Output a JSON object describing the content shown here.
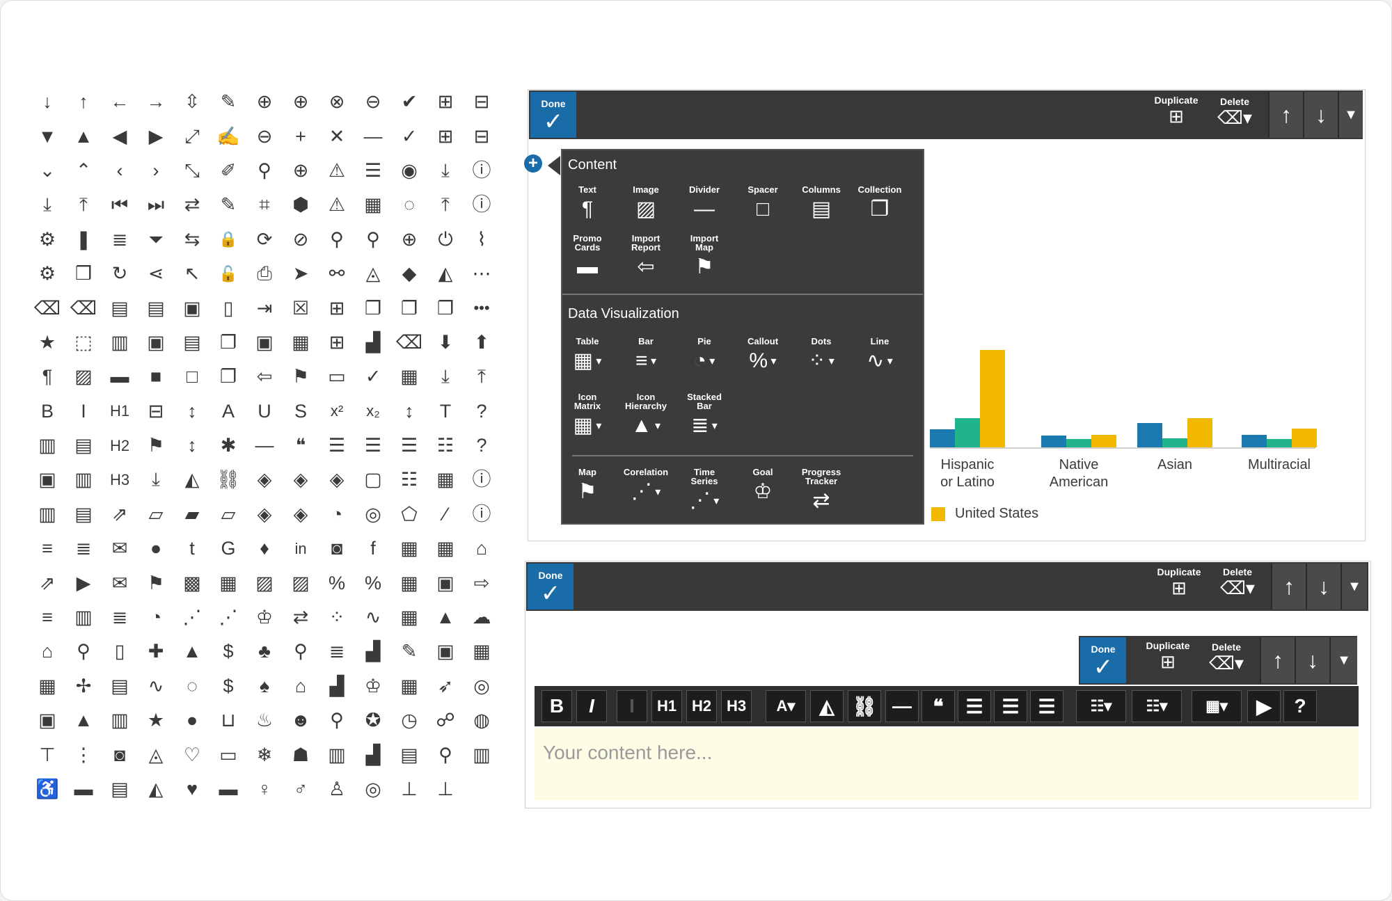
{
  "icon_grid": [
    [
      "arrow-down-icon",
      "↓"
    ],
    [
      "arrow-up-icon",
      "↑"
    ],
    [
      "arrow-left-icon",
      "←"
    ],
    [
      "arrow-right-icon",
      "→"
    ],
    [
      "resize-vertical-icon",
      "⇳"
    ],
    [
      "pencil-icon",
      "✎"
    ],
    [
      "zoom-in-icon",
      "⊕"
    ],
    [
      "circle-plus-icon",
      "⊕"
    ],
    [
      "circle-x-icon",
      "⊗"
    ],
    [
      "circle-minus-icon",
      "⊖"
    ],
    [
      "circle-check-icon",
      "✔"
    ],
    [
      "square-plus-icon",
      "⊞"
    ],
    [
      "square-minus-icon",
      "⊟"
    ],
    [
      "triangle-down-icon",
      "▼"
    ],
    [
      "triangle-up-icon",
      "▲"
    ],
    [
      "triangle-left-icon",
      "◀"
    ],
    [
      "triangle-right-icon",
      "▶"
    ],
    [
      "expand-icon",
      "⤢"
    ],
    [
      "edit-lines-icon",
      "✍"
    ],
    [
      "zoom-out-icon",
      "⊖"
    ],
    [
      "plus-icon",
      "+"
    ],
    [
      "times-icon",
      "✕"
    ],
    [
      "minus-icon",
      "—"
    ],
    [
      "check-icon",
      "✓"
    ],
    [
      "square-plus-outline-icon",
      "⊞"
    ],
    [
      "square-minus-outline-icon",
      "⊟"
    ],
    [
      "chevron-down-icon",
      "⌄"
    ],
    [
      "chevron-up-icon",
      "⌃"
    ],
    [
      "chevron-left-icon",
      "‹"
    ],
    [
      "chevron-right-icon",
      "›"
    ],
    [
      "compress-icon",
      "⤡"
    ],
    [
      "edit-box-icon",
      "✐"
    ],
    [
      "search-icon",
      "⚲"
    ],
    [
      "circle-plus-filled-icon",
      "⊕"
    ],
    [
      "warning-outline-icon",
      "⚠"
    ],
    [
      "list-lines-icon",
      "☰"
    ],
    [
      "eye-icon",
      "◉"
    ],
    [
      "download-icon",
      "⤓"
    ],
    [
      "info-filled-icon",
      "ⓘ"
    ],
    [
      "download-bar-icon",
      "⤓"
    ],
    [
      "upload-bar-icon",
      "⤒"
    ],
    [
      "first-icon",
      "⏮"
    ],
    [
      "last-icon",
      "⏭"
    ],
    [
      "swap-icon",
      "⇄"
    ],
    [
      "edit-doc-icon",
      "✎"
    ],
    [
      "tag-outline-icon",
      "⌗"
    ],
    [
      "tag-icon",
      "⬢"
    ],
    [
      "warning-icon",
      "⚠"
    ],
    [
      "grid-icon",
      "▦"
    ],
    [
      "eye-off-icon",
      "◌"
    ],
    [
      "upload-icon",
      "⤒"
    ],
    [
      "info-outline-icon",
      "ⓘ"
    ],
    [
      "gear-outline-icon",
      "⚙"
    ],
    [
      "bookmark-icon",
      "❚"
    ],
    [
      "database-icon",
      "≣"
    ],
    [
      "filter-icon",
      "⏷"
    ],
    [
      "exchange-icon",
      "⇆"
    ],
    [
      "lock-icon",
      "🔒"
    ],
    [
      "refresh-user-icon",
      "⟳"
    ],
    [
      "ban-icon",
      "⊘"
    ],
    [
      "map-pin-icon",
      "⚲"
    ],
    [
      "map-pin-outline-icon",
      "⚲"
    ],
    [
      "map-pin-plus-icon",
      "⊕"
    ],
    [
      "power-icon",
      "⏻"
    ],
    [
      "paperclip-icon",
      "⌇"
    ],
    [
      "gear-icon",
      "⚙"
    ],
    [
      "bookmark-outline-icon",
      "❒"
    ],
    [
      "sync-icon",
      "↻"
    ],
    [
      "share-icon",
      "⋖"
    ],
    [
      "cursor-icon",
      "↖"
    ],
    [
      "unlock-icon",
      "🔓"
    ],
    [
      "printer-icon",
      "⎙"
    ],
    [
      "send-icon",
      "➤"
    ],
    [
      "eyedropper-icon",
      "⚯"
    ],
    [
      "paint-bucket-outline-icon",
      "◬"
    ],
    [
      "paint-fill-icon",
      "◆"
    ],
    [
      "paint-bucket-icon",
      "◭"
    ],
    [
      "more-circle-icon",
      "⋯"
    ],
    [
      "trash-outline-icon",
      "⌫"
    ],
    [
      "trash-icon",
      "⌫"
    ],
    [
      "report-icon",
      "▤"
    ],
    [
      "document-lines-icon",
      "▤"
    ],
    [
      "csv-file-icon",
      "▣"
    ],
    [
      "blank-file-icon",
      "▯"
    ],
    [
      "file-import-icon",
      "⇥"
    ],
    [
      "file-x-icon",
      "☒"
    ],
    [
      "file-plus-icon",
      "⊞"
    ],
    [
      "files-x-icon",
      "❐"
    ],
    [
      "files-icon",
      "❐"
    ],
    [
      "files-chart-icon",
      "❐"
    ],
    [
      "more-horizontal-icon",
      "•••"
    ],
    [
      "star-icon",
      "★"
    ],
    [
      "select-cursor-icon",
      "⬚"
    ],
    [
      "charts-icon",
      "▥"
    ],
    [
      "map-doc-icon",
      "▣"
    ],
    [
      "doc-lines-icon",
      "▤"
    ],
    [
      "copy-icon",
      "❐"
    ],
    [
      "pin-doc-icon",
      "▣"
    ],
    [
      "calendar-grid-icon",
      "▦"
    ],
    [
      "copy-plus-icon",
      "⊞"
    ],
    [
      "bar-hand-icon",
      "▟"
    ],
    [
      "trash-alt-icon",
      "⌫"
    ],
    [
      "arrow-down-bold-icon",
      "⬇"
    ],
    [
      "arrow-up-bold-icon",
      "⬆"
    ],
    [
      "paragraph-icon",
      "¶"
    ],
    [
      "image-icon",
      "▨"
    ],
    [
      "promo-icon",
      "▬"
    ],
    [
      "square-filled-icon",
      "■"
    ],
    [
      "square-outline-icon",
      "□"
    ],
    [
      "collection-icon",
      "❐"
    ],
    [
      "import-report-icon",
      "⇦"
    ],
    [
      "import-map-icon",
      "⚑"
    ],
    [
      "divider-box-icon",
      "▭"
    ],
    [
      "check-thin-icon",
      "✓"
    ],
    [
      "calendar-icon",
      "▦"
    ],
    [
      "download-line-icon",
      "⤓"
    ],
    [
      "upload-line-icon",
      "⤒"
    ],
    [
      "bold-icon",
      "B"
    ],
    [
      "italic-icon",
      "I"
    ],
    [
      "h1-icon",
      "H1"
    ],
    [
      "minus-square-icon",
      "⊟"
    ],
    [
      "height-icon",
      "↕"
    ],
    [
      "font-size-icon",
      "A"
    ],
    [
      "underline-icon",
      "U"
    ],
    [
      "strikethrough-icon",
      "S"
    ],
    [
      "superscript-icon",
      "x²"
    ],
    [
      "subscript-icon",
      "x₂"
    ],
    [
      "vertical-resize-icon",
      "↕"
    ],
    [
      "text-icon",
      "T"
    ],
    [
      "help-icon",
      "?"
    ],
    [
      "bar-report-icon",
      "▥"
    ],
    [
      "window-icon",
      "▤"
    ],
    [
      "h2-icon",
      "H2"
    ],
    [
      "map-icon",
      "⚑"
    ],
    [
      "vertical-arrows-icon",
      "↕"
    ],
    [
      "asterisk-icon",
      "✱"
    ],
    [
      "dash-icon",
      "—"
    ],
    [
      "quote-icon",
      "❝"
    ],
    [
      "align-left-icon",
      "☰"
    ],
    [
      "align-center-icon",
      "☰"
    ],
    [
      "align-right-icon",
      "☰"
    ],
    [
      "bullet-list-icon",
      "☷"
    ],
    [
      "help-outline-icon",
      "?"
    ],
    [
      "photo-card-icon",
      "▣"
    ],
    [
      "clipboard-chart-icon",
      "▥"
    ],
    [
      "h3-icon",
      "H3"
    ],
    [
      "inbox-download-icon",
      "⤓"
    ],
    [
      "paint-drop-icon",
      "◭"
    ],
    [
      "link-icon",
      "⛓"
    ],
    [
      "layers-icon",
      "◈"
    ],
    [
      "layers-down-icon",
      "◈"
    ],
    [
      "layers-check-icon",
      "◈"
    ],
    [
      "frame-icon",
      "▢"
    ],
    [
      "numbered-list-icon",
      "☷"
    ],
    [
      "table-icon",
      "▦"
    ],
    [
      "info-circle-icon",
      "ⓘ"
    ],
    [
      "chart-doc-icon",
      "▥"
    ],
    [
      "clipboard-icon",
      "▤"
    ],
    [
      "external-link-icon",
      "⇗"
    ],
    [
      "folder-open-icon",
      "▱"
    ],
    [
      "folder-icon",
      "▰"
    ],
    [
      "folder-share-icon",
      "▱"
    ],
    [
      "layers-outline-icon",
      "◈"
    ],
    [
      "layers-plus-icon",
      "◈"
    ],
    [
      "gauge-icon",
      "◔"
    ],
    [
      "circle-ring-icon",
      "◎"
    ],
    [
      "pentagon-icon",
      "⬠"
    ],
    [
      "slash-icon",
      "⁄"
    ],
    [
      "info-outline-alt-icon",
      "ⓘ"
    ],
    [
      "menu-icon",
      "≡"
    ],
    [
      "menu-text-icon",
      "≣"
    ],
    [
      "mail-circle-icon",
      "✉"
    ],
    [
      "circle-badge-icon",
      "●"
    ],
    [
      "tumblr-icon",
      "t"
    ],
    [
      "google-plus-icon",
      "G"
    ],
    [
      "twitter-icon",
      "♦"
    ],
    [
      "linkedin-icon",
      "in"
    ],
    [
      "instagram-icon",
      "◙"
    ],
    [
      "facebook-icon",
      "f"
    ],
    [
      "qr-grid-icon",
      "▦"
    ],
    [
      "qr-filled-icon",
      "▦"
    ],
    [
      "home-icon",
      "⌂"
    ],
    [
      "external-icon",
      "⇗"
    ],
    [
      "video-icon",
      "▶"
    ],
    [
      "envelope-icon",
      "✉"
    ],
    [
      "book-map-icon",
      "⚑"
    ],
    [
      "pattern-icon",
      "▩"
    ],
    [
      "map-grid-icon",
      "▦"
    ],
    [
      "map-chart-icon",
      "▨"
    ],
    [
      "map-dots-icon",
      "▨"
    ],
    [
      "callout-outline-icon",
      "%"
    ],
    [
      "callout-icon",
      "%"
    ],
    [
      "table-outline-icon",
      "▦"
    ],
    [
      "csv-icon",
      "▣"
    ],
    [
      "turn-right-icon",
      "⇨"
    ],
    [
      "bar-horizontal-icon",
      "≡"
    ],
    [
      "bar-chart-icon",
      "▥"
    ],
    [
      "stacked-bar-icon",
      "≣"
    ],
    [
      "pie-icon",
      "◔"
    ],
    [
      "timeseries-icon",
      "⋰"
    ],
    [
      "correlation-icon",
      "⋰"
    ],
    [
      "trophy-icon",
      "♔"
    ],
    [
      "progress-icon",
      "⇄"
    ],
    [
      "dots-icon",
      "⁘"
    ],
    [
      "line-icon",
      "∿"
    ],
    [
      "icon-matrix-icon",
      "▦"
    ],
    [
      "icon-hierarchy-icon",
      "▲"
    ],
    [
      "cloud-upload-icon",
      "☁"
    ],
    [
      "bank-icon",
      "⌂"
    ],
    [
      "bicycle-icon",
      "⚲"
    ],
    [
      "mobile-icon",
      "▯"
    ],
    [
      "medical-bag-icon",
      "✚"
    ],
    [
      "graduation-icon",
      "▲"
    ],
    [
      "money-icon",
      "$"
    ],
    [
      "trees-icon",
      "♣"
    ],
    [
      "walking-icon",
      "⚲"
    ],
    [
      "coins-icon",
      "≣"
    ],
    [
      "chart-grow-icon",
      "▟"
    ],
    [
      "tools-icon",
      "✎"
    ],
    [
      "puzzle-icon",
      "▣"
    ],
    [
      "calendar-check-icon",
      "▦"
    ],
    [
      "grid-chart-icon",
      "▦"
    ],
    [
      "road-icon",
      "✢"
    ],
    [
      "dashboard-icon",
      "▤"
    ],
    [
      "pulse-icon",
      "∿"
    ],
    [
      "lightbulb-outline-icon",
      "◌"
    ],
    [
      "location-money-icon",
      "$"
    ],
    [
      "leaf-icon",
      "♠"
    ],
    [
      "house-icon",
      "⌂"
    ],
    [
      "bar-up-icon",
      "▟"
    ],
    [
      "trophy-alt-icon",
      "♔"
    ],
    [
      "calendar-alt-icon",
      "▦"
    ],
    [
      "rocket-icon",
      "➶"
    ],
    [
      "compass-icon",
      "◎"
    ],
    [
      "id-card-icon",
      "▣"
    ],
    [
      "alert-triangle-icon",
      "▲"
    ],
    [
      "building-chart-icon",
      "▥"
    ],
    [
      "shield-star-icon",
      "★"
    ],
    [
      "lightbulb-icon",
      "●"
    ],
    [
      "cart-icon",
      "⊔"
    ],
    [
      "fire-icon",
      "♨"
    ],
    [
      "group-icon",
      "☻"
    ],
    [
      "zoom-chart-icon",
      "⚲"
    ],
    [
      "award-icon",
      "✪"
    ],
    [
      "clock-icon",
      "◷"
    ],
    [
      "satellite-icon",
      "☍"
    ],
    [
      "globe-icon",
      "◍"
    ],
    [
      "crane-icon",
      "⊤"
    ],
    [
      "traffic-light-icon",
      "⋮"
    ],
    [
      "camera-icon",
      "◙"
    ],
    [
      "bell-outline-icon",
      "◬"
    ],
    [
      "heart-outline-icon",
      "♡"
    ],
    [
      "comment-outline-icon",
      "▭"
    ],
    [
      "snowflake-icon",
      "❄"
    ],
    [
      "person-icon",
      "☗"
    ],
    [
      "chat-chart-icon",
      "▥"
    ],
    [
      "bar-growth-icon",
      "▟"
    ],
    [
      "checklist-icon",
      "▤"
    ],
    [
      "map-person-icon",
      "⚲"
    ],
    [
      "chart-window-icon",
      "▥"
    ],
    [
      "wheelchair-icon",
      "♿"
    ],
    [
      "briefcase-icon",
      "▬"
    ],
    [
      "news-icon",
      "▤"
    ],
    [
      "bell-icon",
      "◭"
    ],
    [
      "heart-icon",
      "♥"
    ],
    [
      "comment-icon",
      "▬"
    ],
    [
      "female-icon",
      "♀"
    ],
    [
      "male-icon",
      "♂"
    ],
    [
      "person-alt-icon",
      "♙"
    ],
    [
      "target-icon",
      "◎"
    ],
    [
      "pin-outline-icon",
      "⊥"
    ],
    [
      "pin-icon",
      "⊥"
    ]
  ],
  "panel_top": {
    "done_label": "Done",
    "duplicate_label": "Duplicate",
    "delete_label": "Delete"
  },
  "panel_bottom": {
    "done_label": "Done",
    "duplicate_label": "Duplicate",
    "delete_label": "Delete"
  },
  "panel_inner": {
    "done_label": "Done",
    "duplicate_label": "Duplicate",
    "delete_label": "Delete"
  },
  "popup": {
    "content_title": "Content",
    "dataviz_title": "Data Visualization",
    "content_items": [
      {
        "label": "Text",
        "icon": "¶"
      },
      {
        "label": "Image",
        "icon": "▨"
      },
      {
        "label": "Divider",
        "icon": "—"
      },
      {
        "label": "Spacer",
        "icon": "□"
      },
      {
        "label": "Columns",
        "icon": "▤"
      },
      {
        "label": "Collection",
        "icon": "❐"
      },
      {
        "label": "Promo Cards",
        "icon": "▬"
      },
      {
        "label": "Import Report",
        "icon": "⇦"
      },
      {
        "label": "Import Map",
        "icon": "⚑"
      }
    ],
    "dataviz_items": [
      {
        "label": "Table",
        "icon": "▦"
      },
      {
        "label": "Bar",
        "icon": "≡"
      },
      {
        "label": "Pie",
        "icon": "◔"
      },
      {
        "label": "Callout",
        "icon": "%"
      },
      {
        "label": "Dots",
        "icon": "⁘"
      },
      {
        "label": "Line",
        "icon": "∿"
      },
      {
        "label": "Icon Matrix",
        "icon": "▦"
      },
      {
        "label": "Icon Hierarchy",
        "icon": "▲"
      },
      {
        "label": "Stacked Bar",
        "icon": "≣"
      },
      {
        "label": "Map",
        "icon": "⚑"
      },
      {
        "label": "Corelation",
        "icon": "⋰"
      },
      {
        "label": "Time Series",
        "icon": "⋰"
      },
      {
        "label": "Goal",
        "icon": "♔"
      },
      {
        "label": "Progress Tracker",
        "icon": "⇄"
      }
    ]
  },
  "chart_data": {
    "type": "bar",
    "categories": [
      "Hispanic or Latino",
      "Native American",
      "Asian",
      "Multiracial"
    ],
    "series": [
      {
        "color": "#1a7ab0",
        "values": [
          26,
          17,
          35,
          18
        ]
      },
      {
        "color": "#1fb48c",
        "values": [
          42,
          12,
          13,
          12
        ]
      },
      {
        "name": "United States",
        "color": "#f2b800",
        "values": [
          140,
          18,
          42,
          27
        ]
      }
    ],
    "legend_position": "bottom-left",
    "grid": false
  },
  "editor": {
    "placeholder": "Your content here..."
  },
  "rt_toolbar": [
    {
      "name": "bold-button",
      "icon": "B"
    },
    {
      "name": "italic-button",
      "icon": "I"
    },
    {
      "name": "font-placeholder-button",
      "icon": "I"
    },
    {
      "name": "h1-button",
      "icon": "H1"
    },
    {
      "name": "h2-button",
      "icon": "H2"
    },
    {
      "name": "h3-button",
      "icon": "H3"
    },
    {
      "name": "font-size-button",
      "icon": "A▾"
    },
    {
      "name": "fill-color-button",
      "icon": "◭"
    },
    {
      "name": "link-button",
      "icon": "⛓"
    },
    {
      "name": "divider-button",
      "icon": "—"
    },
    {
      "name": "quote-button",
      "icon": "❝"
    },
    {
      "name": "align-left-button",
      "icon": "☰"
    },
    {
      "name": "align-center-button",
      "icon": "☰"
    },
    {
      "name": "align-right-button",
      "icon": "☰"
    },
    {
      "name": "bullet-list-button",
      "icon": "☷▾"
    },
    {
      "name": "numbered-list-button",
      "icon": "☷▾"
    },
    {
      "name": "table-button",
      "icon": "▦▾"
    },
    {
      "name": "video-button",
      "icon": "▶"
    },
    {
      "name": "help-button",
      "icon": "?"
    }
  ]
}
